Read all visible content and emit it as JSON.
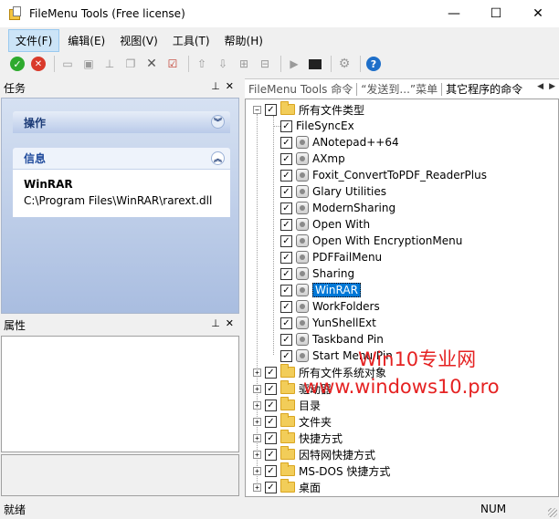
{
  "window": {
    "title": "FileMenu Tools (Free license)",
    "minimize": "—",
    "maximize": "☐",
    "close": "✕"
  },
  "menu": [
    "文件(F)",
    "编辑(E)",
    "视图(V)",
    "工具(T)",
    "帮助(H)"
  ],
  "toolbar": {
    "apply_icon": "check-icon",
    "discard_icon": "cancel-icon",
    "help_label": "?"
  },
  "tasks_pane": {
    "title": "任务",
    "pin": "ᵖ",
    "close": "✕",
    "group_actions": "操作",
    "group_info": "信息",
    "info_name": "WinRAR",
    "info_path": "C:\\Program Files\\WinRAR\\rarext.dll"
  },
  "props_pane": {
    "title": "属性",
    "pin": "ᵖ",
    "close": "✕"
  },
  "tabs": [
    "FileMenu Tools 命令",
    "“发送到...”菜单",
    "其它程序的命令"
  ],
  "tree": {
    "root": "所有文件类型",
    "children": [
      "FileSyncEx",
      "ANotepad++64",
      "AXmp",
      "Foxit_ConvertToPDF_ReaderPlus",
      "Glary Utilities",
      "ModernSharing",
      "Open With",
      "Open With EncryptionMenu",
      "PDFFailMenu",
      "Sharing",
      "WinRAR",
      "WorkFolders",
      "YunShellExt",
      "Taskband Pin",
      "Start Menu Pin"
    ],
    "selected": "WinRAR",
    "folders": [
      "所有文件系统对象",
      "驱动器",
      "目录",
      "文件夹",
      "快捷方式",
      "因特网快捷方式",
      "MS-DOS 快捷方式",
      "桌面"
    ]
  },
  "watermark": {
    "line1": "Win10专业网",
    "line2": "www.windows10.pro"
  },
  "status": {
    "left": "就绪",
    "right": "NUM"
  }
}
